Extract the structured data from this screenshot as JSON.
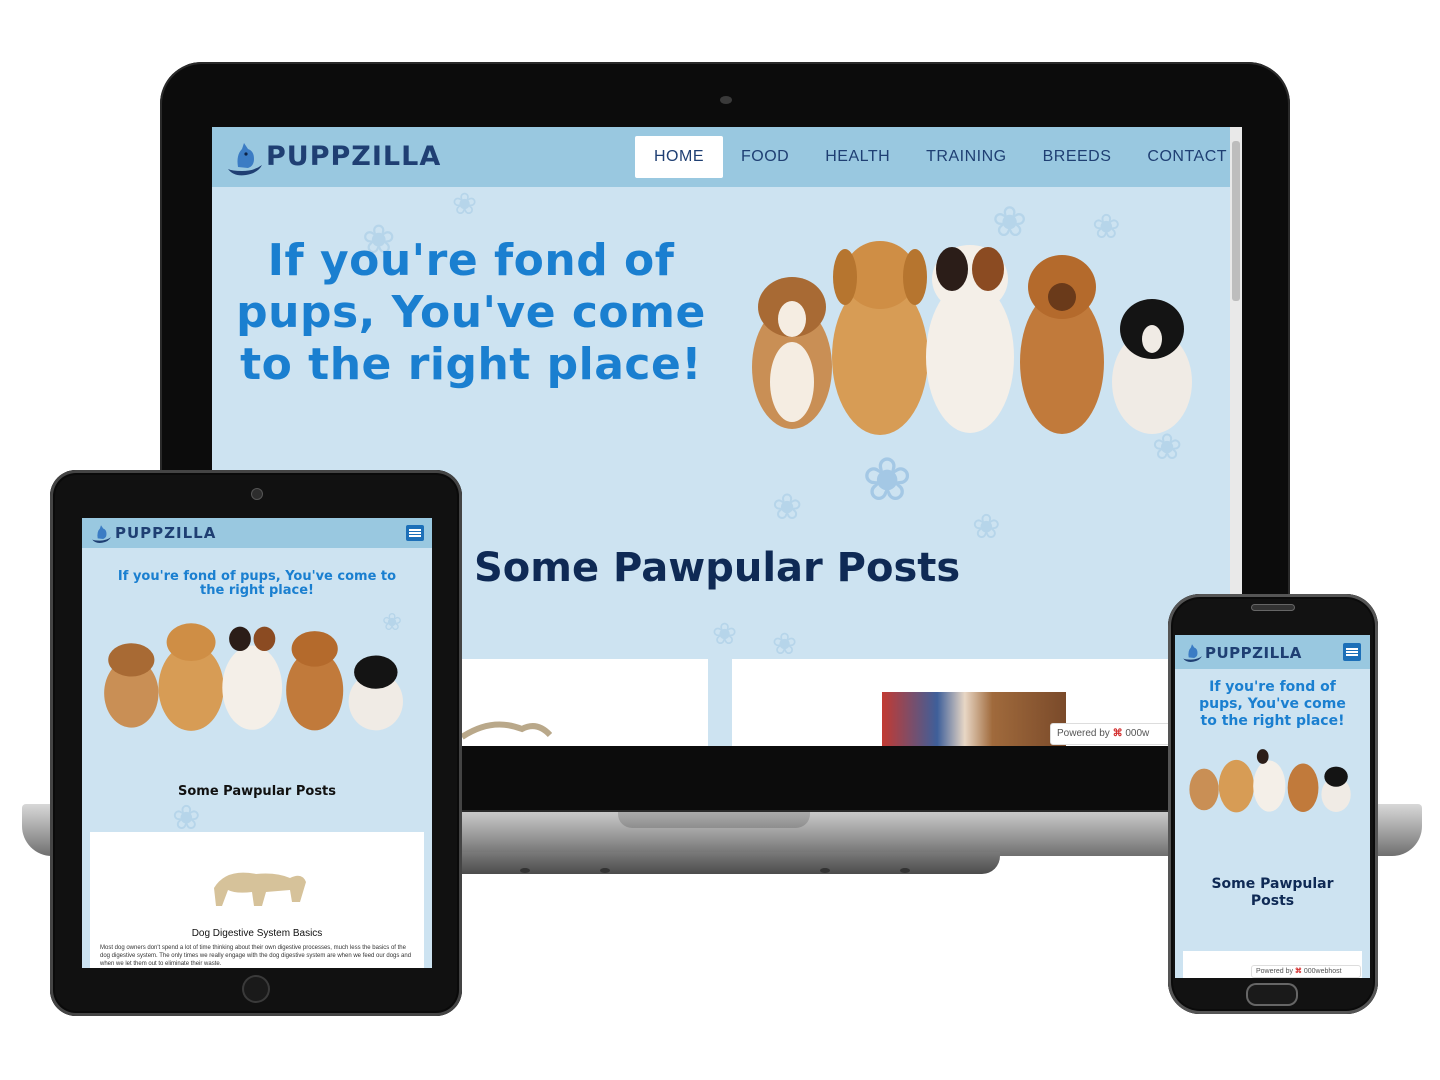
{
  "site": {
    "logo": "PUPPZILLA",
    "hero_title": "If you're fond of pups, You've come to the right place!",
    "hero_lines": [
      "If you're fond of",
      "pups, You've come",
      "to the right place!"
    ],
    "section_title": "Some Pawpular Posts",
    "nav": [
      {
        "label": "HOME",
        "active": true
      },
      {
        "label": "FOOD",
        "active": false
      },
      {
        "label": "HEALTH",
        "active": false
      },
      {
        "label": "TRAINING",
        "active": false
      },
      {
        "label": "BREEDS",
        "active": false
      },
      {
        "label": "CONTACT",
        "active": false
      }
    ],
    "powered_by": "Powered by",
    "powered_brand_laptop": "000w",
    "powered_brand": "000webhost"
  },
  "tablet": {
    "hero_line1": "If you're fond of pups, You've come to",
    "hero_line2": "the right place!",
    "section_title": "Some Pawpular Posts",
    "post_title": "Dog Digestive System Basics",
    "post_excerpt": "Most dog owners don't spend a lot of time thinking about their own digestive processes, much less the basics of the dog digestive system. The only times we really engage with the dog digestive system are when we feed our dogs and when we let them out to eliminate their waste."
  },
  "phone": {
    "hero_lines": [
      "If you're fond of",
      "pups, You've come",
      "to the right place!"
    ],
    "section_lines": [
      "Some Pawpular",
      "Posts"
    ]
  },
  "colors": {
    "header_bg": "#99c8e0",
    "page_bg": "#cde3f1",
    "hero_text": "#1a7fd0",
    "title_text": "#0f2a55",
    "nav_text": "#1f3f73",
    "menu_button": "#1c6fb8"
  },
  "icons": [
    "dog-logo-icon",
    "hamburger-menu-icon",
    "paw-print-icon",
    "webhost-logo-icon"
  ]
}
